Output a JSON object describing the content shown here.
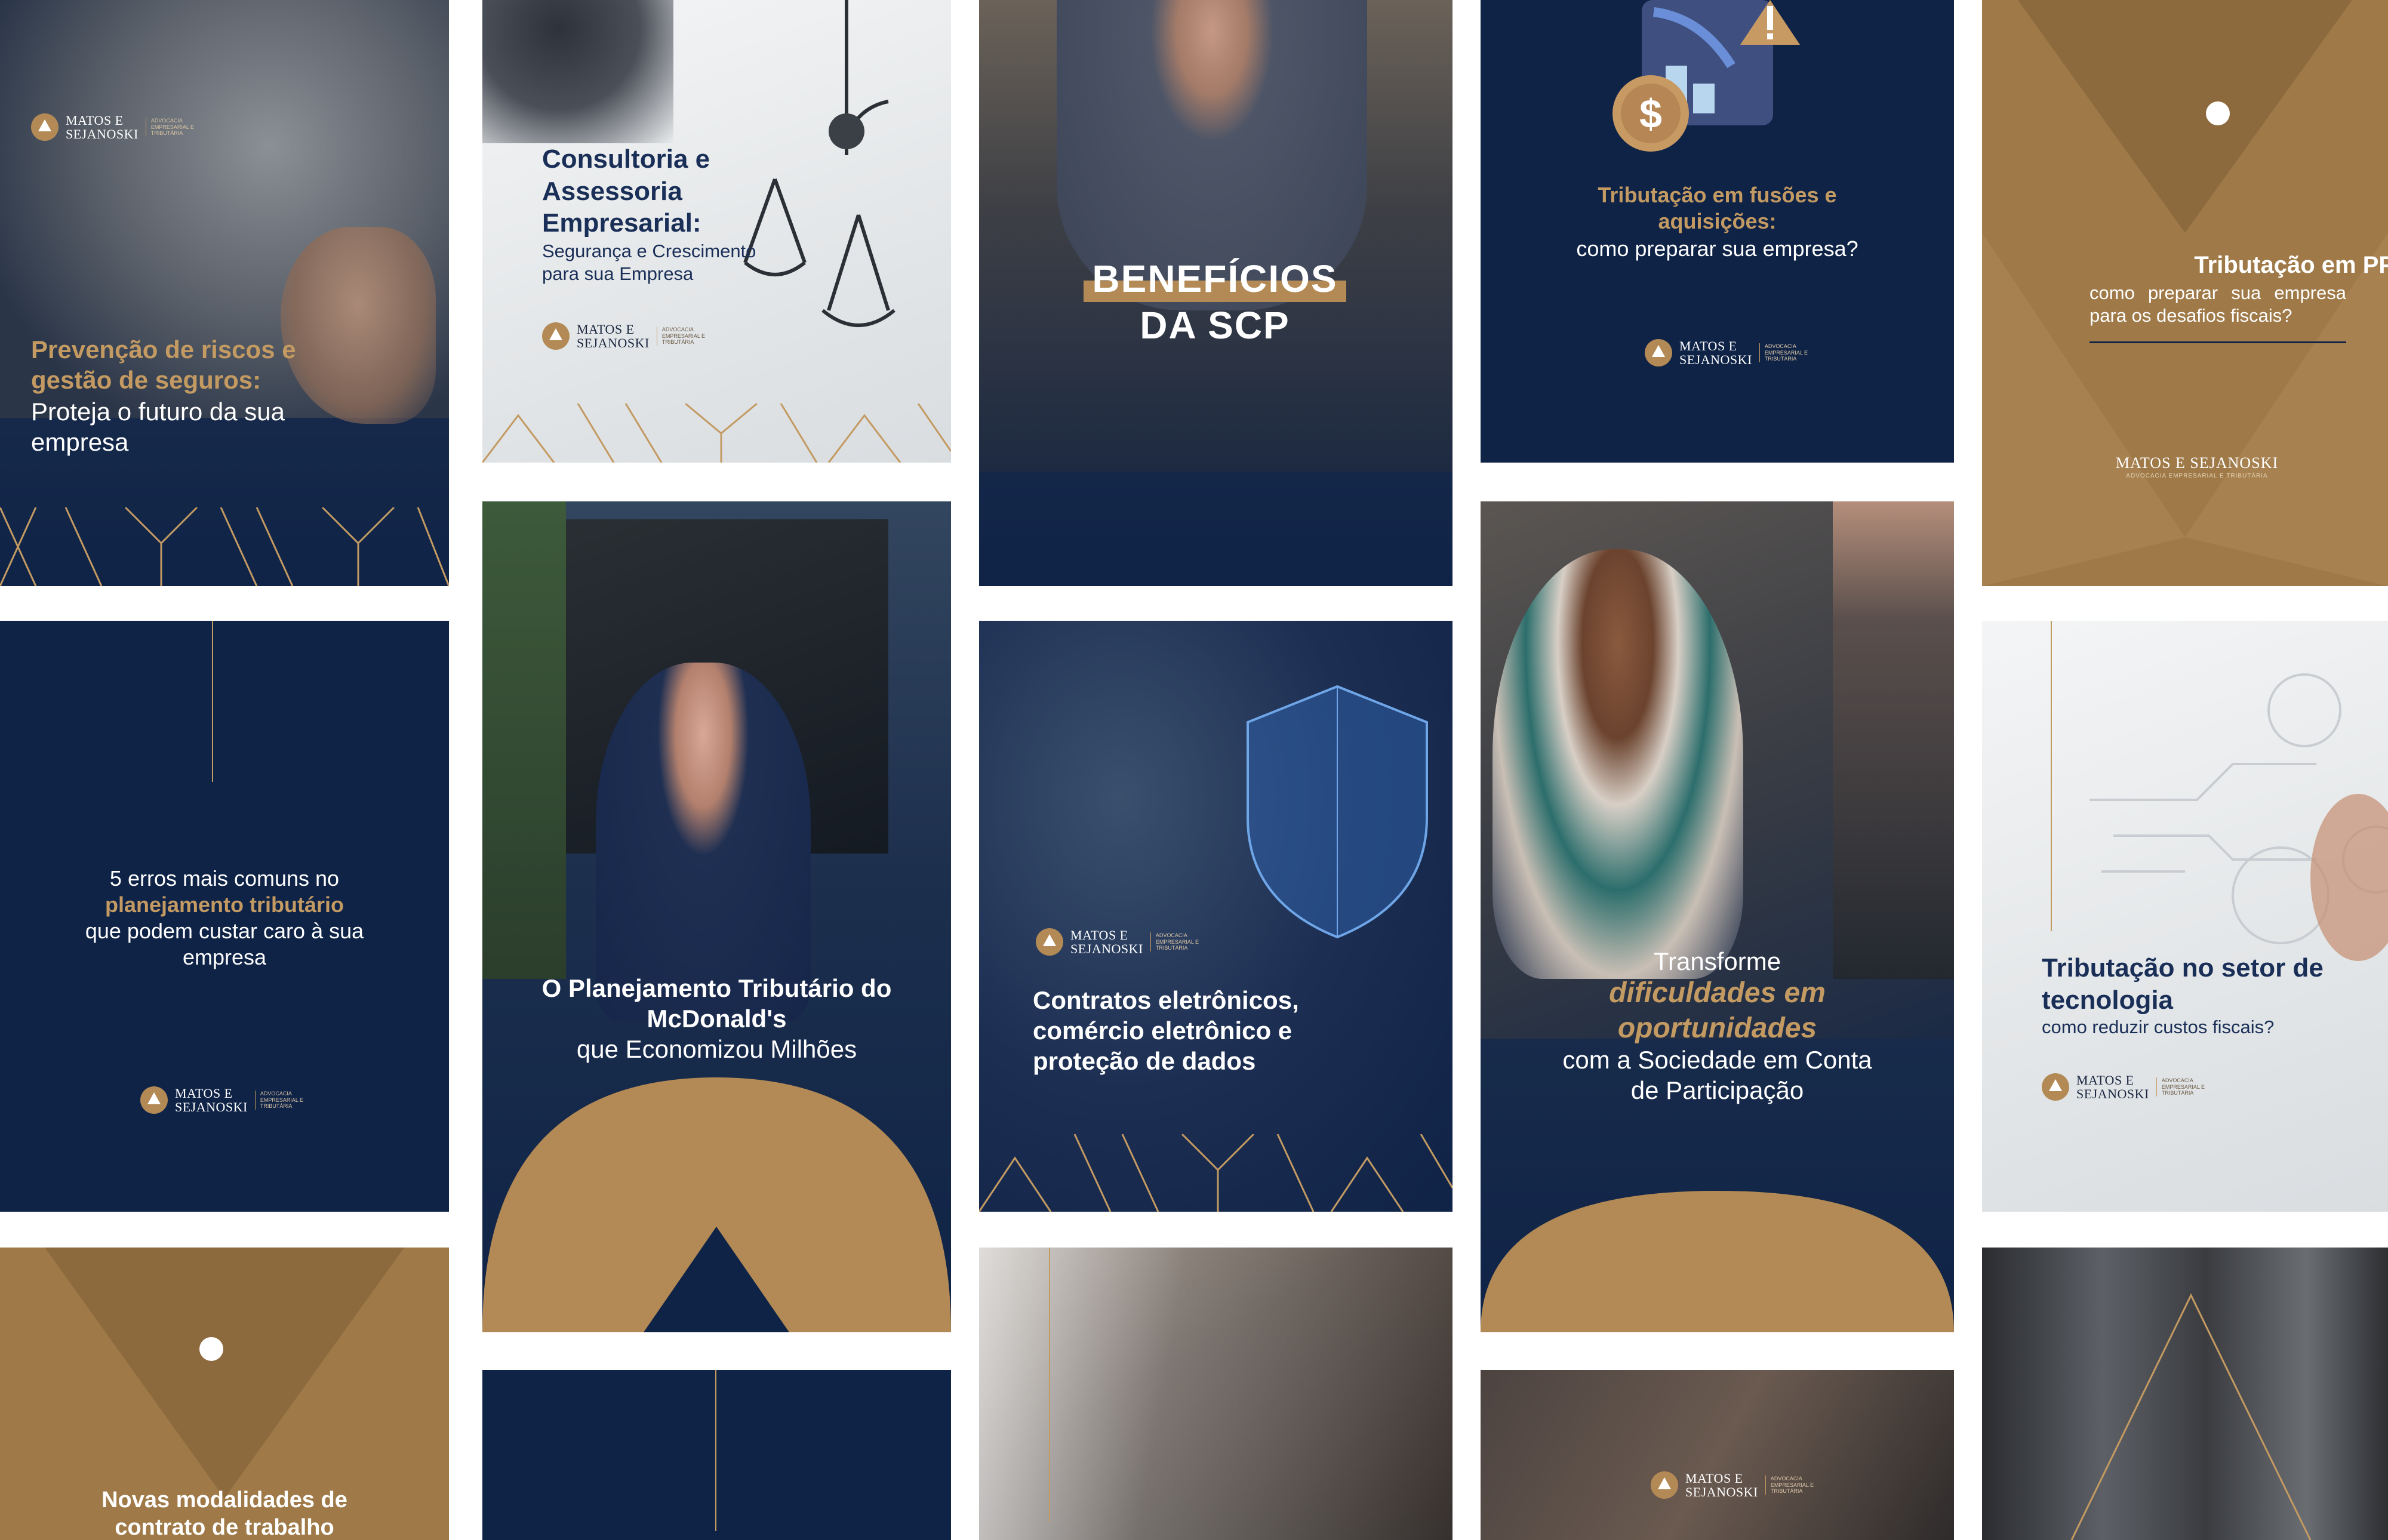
{
  "brand": {
    "name_line": "MATOS E\nSEJANOSKI",
    "name_single": "MATOS E SEJANOSKI",
    "tagline": "ADVOCACIA EMPRESARIAL E TRIBUTÁRIA",
    "colors": {
      "navy": "#0f2347",
      "gold": "#c39a62",
      "gold_dark": "#9f7a48",
      "white": "#ffffff"
    }
  },
  "cards": {
    "riscos": {
      "title_gold": "Prevenção de riscos e gestão de seguros:",
      "subtitle": "Proteja o futuro da sua empresa"
    },
    "consultoria": {
      "title": "Consultoria e Assessoria Empresarial:",
      "subtitle": "Segurança e Crescimento para sua Empresa"
    },
    "scp": {
      "title": "BENEFÍCIOS DA SCP"
    },
    "fusoes": {
      "title_gold": "Tributação em fusões e aquisições:",
      "subtitle": "como preparar sua empresa?"
    },
    "ppps": {
      "title": "Tributação em PPPs",
      "subtitle": "como preparar sua empresa para os desafios fiscais?"
    },
    "erros": {
      "line1": "5 erros mais comuns no",
      "line_gold": "planejamento tributário",
      "line3": "que podem custar caro à sua empresa"
    },
    "mcdonalds": {
      "title": "O Planejamento Tributário do McDonald's",
      "subtitle": "que Economizou Milhões"
    },
    "contratos": {
      "title": "Contratos eletrônicos, comércio eletrônico e proteção de dados"
    },
    "transforme": {
      "line1": "Transforme",
      "line_gold": "dificuldades em oportunidades",
      "line3": "com a Sociedade em Conta de Participação"
    },
    "tecnologia": {
      "title": "Tributação no setor de tecnologia",
      "subtitle": "como reduzir custos fiscais?"
    },
    "novas": {
      "title": "Novas modalidades de contrato de trabalho"
    }
  },
  "icons": [
    "logo-mark-icon",
    "dollar-coin-icon",
    "warning-icon",
    "chart-down-icon",
    "shield-icon",
    "scale-icon"
  ]
}
